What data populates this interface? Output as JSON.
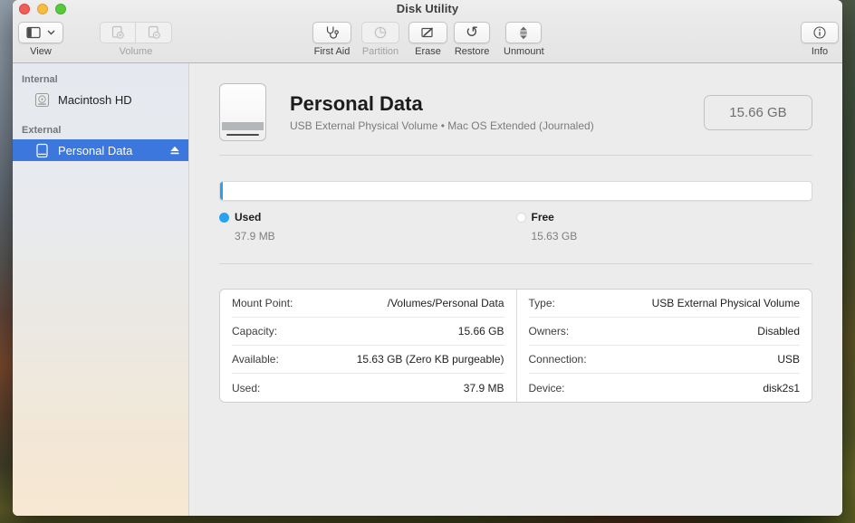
{
  "window": {
    "title": "Disk Utility"
  },
  "toolbar": {
    "view": {
      "label": "View"
    },
    "volume": {
      "label": "Volume",
      "enabled": false
    },
    "first_aid": {
      "label": "First Aid",
      "enabled": true
    },
    "partition": {
      "label": "Partition",
      "enabled": false
    },
    "erase": {
      "label": "Erase",
      "enabled": true
    },
    "restore": {
      "label": "Restore",
      "enabled": true,
      "glyph": "↺"
    },
    "unmount": {
      "label": "Unmount",
      "enabled": true
    },
    "info": {
      "label": "Info",
      "enabled": true
    }
  },
  "sidebar": {
    "sections": [
      {
        "header": "Internal",
        "items": [
          {
            "label": "Macintosh HD",
            "selected": false
          }
        ]
      },
      {
        "header": "External",
        "items": [
          {
            "label": "Personal Data",
            "selected": true,
            "eject": true
          }
        ]
      }
    ]
  },
  "main": {
    "title": "Personal Data",
    "subtitle": "USB External Physical Volume • Mac OS Extended (Journaled)",
    "capacity_badge": "15.66 GB",
    "usage": {
      "used_label": "Used",
      "used_value": "37.9 MB",
      "free_label": "Free",
      "free_value": "15.63 GB",
      "used_fraction": 0.0024,
      "used_color": "#2aa1ef",
      "free_color": "#ffffff"
    },
    "details": {
      "left": [
        {
          "label": "Mount Point:",
          "value": "/Volumes/Personal Data"
        },
        {
          "label": "Capacity:",
          "value": "15.66 GB"
        },
        {
          "label": "Available:",
          "value": "15.63 GB (Zero KB purgeable)"
        },
        {
          "label": "Used:",
          "value": "37.9 MB"
        }
      ],
      "right": [
        {
          "label": "Type:",
          "value": "USB External Physical Volume"
        },
        {
          "label": "Owners:",
          "value": "Disabled"
        },
        {
          "label": "Connection:",
          "value": "USB"
        },
        {
          "label": "Device:",
          "value": "disk2s1"
        }
      ]
    }
  },
  "colors": {
    "selection_blue": "#3b77dd",
    "used_blue": "#2aa1ef",
    "window_bg": "#ececec"
  }
}
